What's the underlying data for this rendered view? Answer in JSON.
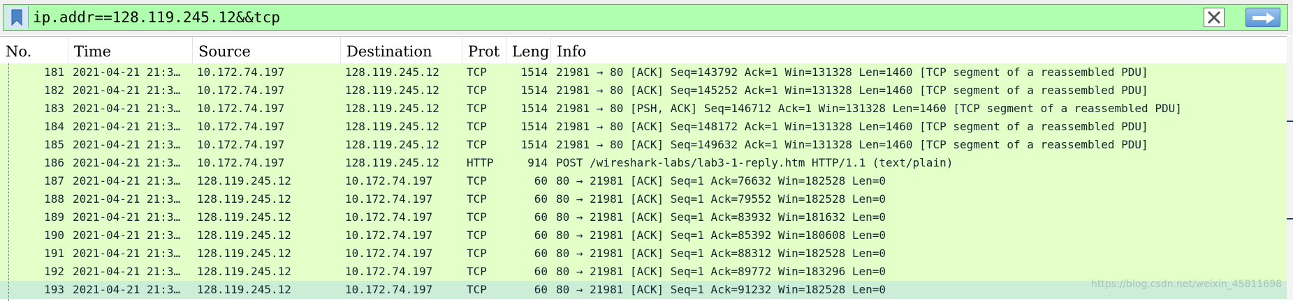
{
  "filter": {
    "value": "ip.addr==128.119.245.12&&tcp",
    "bookmark_icon": "bookmark-icon",
    "clear_icon": "close-icon",
    "apply_icon": "arrow-right-icon"
  },
  "columns": {
    "no": "No.",
    "time": "Time",
    "source": "Source",
    "destination": "Destination",
    "protocol": "Prot",
    "length": "Leng",
    "info": "Info"
  },
  "packets": [
    {
      "no": "181",
      "time": "2021-04-21 21:3…",
      "source": "10.172.74.197",
      "destination": "128.119.245.12",
      "protocol": "TCP",
      "length": "1514",
      "info": "21981 → 80 [ACK] Seq=143792 Ack=1 Win=131328 Len=1460 [TCP segment of a reassembled PDU]"
    },
    {
      "no": "182",
      "time": "2021-04-21 21:3…",
      "source": "10.172.74.197",
      "destination": "128.119.245.12",
      "protocol": "TCP",
      "length": "1514",
      "info": "21981 → 80 [ACK] Seq=145252 Ack=1 Win=131328 Len=1460 [TCP segment of a reassembled PDU]"
    },
    {
      "no": "183",
      "time": "2021-04-21 21:3…",
      "source": "10.172.74.197",
      "destination": "128.119.245.12",
      "protocol": "TCP",
      "length": "1514",
      "info": "21981 → 80 [PSH, ACK] Seq=146712 Ack=1 Win=131328 Len=1460 [TCP segment of a reassembled PDU]"
    },
    {
      "no": "184",
      "time": "2021-04-21 21:3…",
      "source": "10.172.74.197",
      "destination": "128.119.245.12",
      "protocol": "TCP",
      "length": "1514",
      "info": "21981 → 80 [ACK] Seq=148172 Ack=1 Win=131328 Len=1460 [TCP segment of a reassembled PDU]"
    },
    {
      "no": "185",
      "time": "2021-04-21 21:3…",
      "source": "10.172.74.197",
      "destination": "128.119.245.12",
      "protocol": "TCP",
      "length": "1514",
      "info": "21981 → 80 [ACK] Seq=149632 Ack=1 Win=131328 Len=1460 [TCP segment of a reassembled PDU]"
    },
    {
      "no": "186",
      "time": "2021-04-21 21:3…",
      "source": "10.172.74.197",
      "destination": "128.119.245.12",
      "protocol": "HTTP",
      "length": "914",
      "info": "POST /wireshark-labs/lab3-1-reply.htm HTTP/1.1  (text/plain)"
    },
    {
      "no": "187",
      "time": "2021-04-21 21:3…",
      "source": "128.119.245.12",
      "destination": "10.172.74.197",
      "protocol": "TCP",
      "length": "60",
      "info": "80 → 21981 [ACK] Seq=1 Ack=76632 Win=182528 Len=0"
    },
    {
      "no": "188",
      "time": "2021-04-21 21:3…",
      "source": "128.119.245.12",
      "destination": "10.172.74.197",
      "protocol": "TCP",
      "length": "60",
      "info": "80 → 21981 [ACK] Seq=1 Ack=79552 Win=182528 Len=0"
    },
    {
      "no": "189",
      "time": "2021-04-21 21:3…",
      "source": "128.119.245.12",
      "destination": "10.172.74.197",
      "protocol": "TCP",
      "length": "60",
      "info": "80 → 21981 [ACK] Seq=1 Ack=83932 Win=181632 Len=0"
    },
    {
      "no": "190",
      "time": "2021-04-21 21:3…",
      "source": "128.119.245.12",
      "destination": "10.172.74.197",
      "protocol": "TCP",
      "length": "60",
      "info": "80 → 21981 [ACK] Seq=1 Ack=85392 Win=180608 Len=0"
    },
    {
      "no": "191",
      "time": "2021-04-21 21:3…",
      "source": "128.119.245.12",
      "destination": "10.172.74.197",
      "protocol": "TCP",
      "length": "60",
      "info": "80 → 21981 [ACK] Seq=1 Ack=88312 Win=182528 Len=0"
    },
    {
      "no": "192",
      "time": "2021-04-21 21:3…",
      "source": "128.119.245.12",
      "destination": "10.172.74.197",
      "protocol": "TCP",
      "length": "60",
      "info": "80 → 21981 [ACK] Seq=1 Ack=89772 Win=183296 Len=0"
    },
    {
      "no": "193",
      "time": "2021-04-21 21:3…",
      "source": "128.119.245.12",
      "destination": "10.172.74.197",
      "protocol": "TCP",
      "length": "60",
      "info": "80 → 21981 [ACK] Seq=1 Ack=91232 Win=182528 Len=0",
      "selected": true
    }
  ],
  "colors": {
    "filter_valid_bg": "#afffaf",
    "tcp_row_bg": "#e4ffc7",
    "selected_row_bg": "#cdeed6"
  },
  "watermark": "https://blog.csdn.net/weixin_45811698"
}
